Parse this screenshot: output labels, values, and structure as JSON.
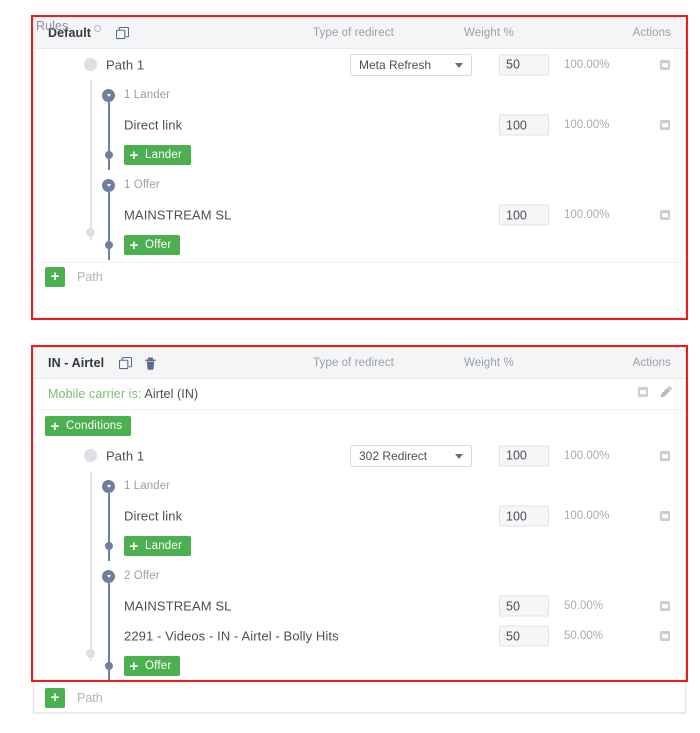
{
  "page": {
    "rules_label": "Rules"
  },
  "columns": {
    "redirect": "Type of redirect",
    "weight": "Weight %",
    "actions": "Actions"
  },
  "add_path": {
    "label": "Path",
    "plus": "+"
  },
  "buttons": {
    "lander": "Lander",
    "offer": "Offer",
    "conditions": "Conditions",
    "plus": "+"
  },
  "panels": [
    {
      "id": "default",
      "title": "Default",
      "icons": [
        "duplicate-icon"
      ],
      "path": {
        "label": "Path 1",
        "redirect": "Meta Refresh",
        "weight": "50",
        "percent": "100.00%"
      },
      "groups": [
        {
          "header": "1 Lander",
          "type": "lander",
          "add_label": "Lander",
          "items": [
            {
              "name": "Direct link",
              "weight": "100",
              "percent": "100.00%"
            }
          ]
        },
        {
          "header": "1 Offer",
          "type": "offer",
          "add_label": "Offer",
          "items": [
            {
              "name": "MAINSTREAM SL",
              "weight": "100",
              "percent": "100.00%"
            }
          ]
        }
      ]
    },
    {
      "id": "airtel",
      "title": "IN - Airtel",
      "icons": [
        "duplicate-icon",
        "trash-icon"
      ],
      "condition": {
        "prefix": "Mobile carrier is:",
        "value": "Airtel (IN)",
        "actions": [
          "delete-icon",
          "edit-icon"
        ]
      },
      "conditions_button": "Conditions",
      "path": {
        "label": "Path 1",
        "redirect": "302 Redirect",
        "weight": "100",
        "percent": "100.00%"
      },
      "groups": [
        {
          "header": "1 Lander",
          "type": "lander",
          "add_label": "Lander",
          "items": [
            {
              "name": "Direct link",
              "weight": "100",
              "percent": "100.00%"
            }
          ]
        },
        {
          "header": "2 Offer",
          "type": "offer",
          "add_label": "Offer",
          "items": [
            {
              "name": "MAINSTREAM SL",
              "weight": "50",
              "percent": "50.00%"
            },
            {
              "name": "2291 - Videos - IN - Airtel - Bolly Hits",
              "weight": "50",
              "percent": "50.00%"
            }
          ]
        }
      ]
    }
  ],
  "colors": {
    "green": "#4caf50",
    "annotation_red": "#ef1b1b",
    "node_blue": "#6f7f9e",
    "header_bg": "#f4f5f6"
  }
}
